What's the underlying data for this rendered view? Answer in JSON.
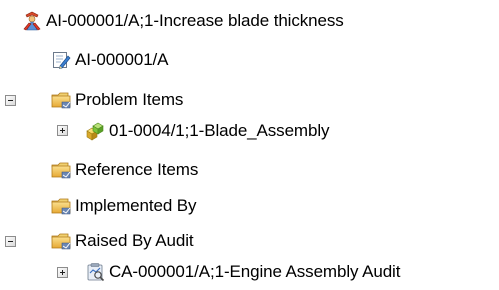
{
  "tree": {
    "root": {
      "label": "AI-000001/A;1-Increase blade thickness",
      "icon": "change-request-icon"
    },
    "revision": {
      "label": "AI-000001/A",
      "icon": "document-edit-icon"
    },
    "problem_items": {
      "label": "Problem Items",
      "icon": "folder-icon",
      "expanded": true,
      "children": [
        {
          "label": "01-0004/1;1-Blade_Assembly",
          "icon": "assembly-icon",
          "expanded": false
        }
      ]
    },
    "reference_items": {
      "label": "Reference Items",
      "icon": "folder-icon"
    },
    "implemented_by": {
      "label": "Implemented By",
      "icon": "folder-icon"
    },
    "raised_by_audit": {
      "label": "Raised By Audit",
      "icon": "folder-icon",
      "expanded": true,
      "children": [
        {
          "label": "CA-000001/A;1-Engine Assembly Audit",
          "icon": "audit-icon",
          "expanded": false
        }
      ]
    }
  },
  "colors": {
    "folder_yellow": "#f3c650",
    "folder_orange": "#e29a2a",
    "expander_border": "#8c8c8c",
    "text": "#000000"
  }
}
